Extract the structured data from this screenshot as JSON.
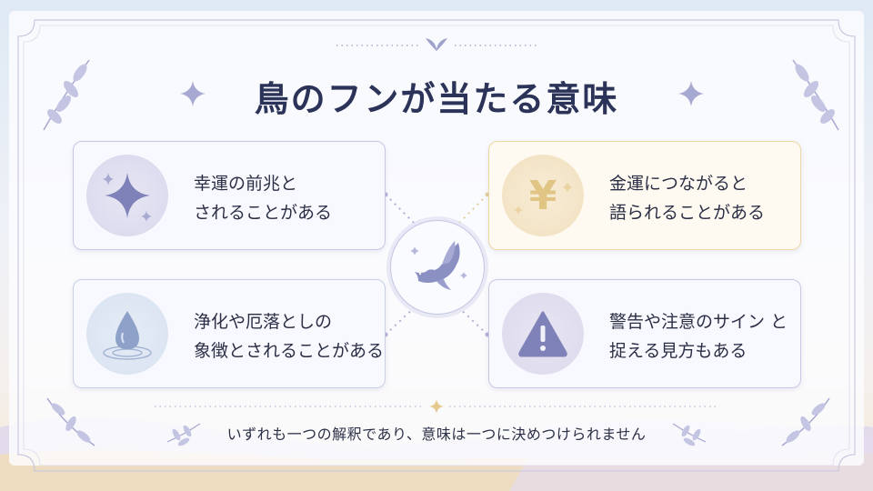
{
  "title": "鳥のフンが当たる意味",
  "cards": [
    {
      "line1": "幸運の前兆と",
      "line2": "されることがある",
      "icon": "sparkle-icon"
    },
    {
      "line1": "金運につながると",
      "line2": "語られることがある",
      "icon": "yen-icon"
    },
    {
      "line1": "浄化や厄落としの",
      "line2": "象徴とされることがある",
      "icon": "water-drop-icon"
    },
    {
      "line1": "警告や注意のサイン と",
      "line2": "捉える見方もある",
      "icon": "warning-icon"
    }
  ],
  "center_icon": "dove-icon",
  "footer": "いずれも一つの解釈であり、意味は一つに決めつけられません",
  "colors": {
    "title": "#2c3358",
    "accent_lavender": "#8f92c4",
    "accent_gold": "#e4c78a"
  }
}
